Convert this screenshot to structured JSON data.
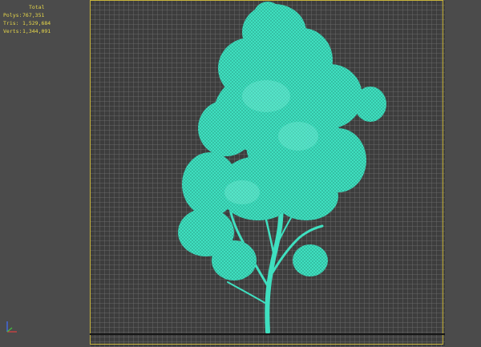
{
  "stats": {
    "header": "Total",
    "rows": [
      {
        "label": "Polys:",
        "value": "767,351"
      },
      {
        "label": "Tris:",
        "value": "1,529,684"
      },
      {
        "label": "Verts:",
        "value": "1,344,091"
      }
    ]
  },
  "colors": {
    "foliage": "#3fe0c0",
    "foliage_light": "#7ff2dc",
    "frame": "#c8b43c",
    "stats_text": "#e8d84a",
    "axis_x": "#e04040",
    "axis_y": "#40c040",
    "axis_z": "#4070ff"
  },
  "icons": {
    "axis": "axis-tripod-icon"
  }
}
